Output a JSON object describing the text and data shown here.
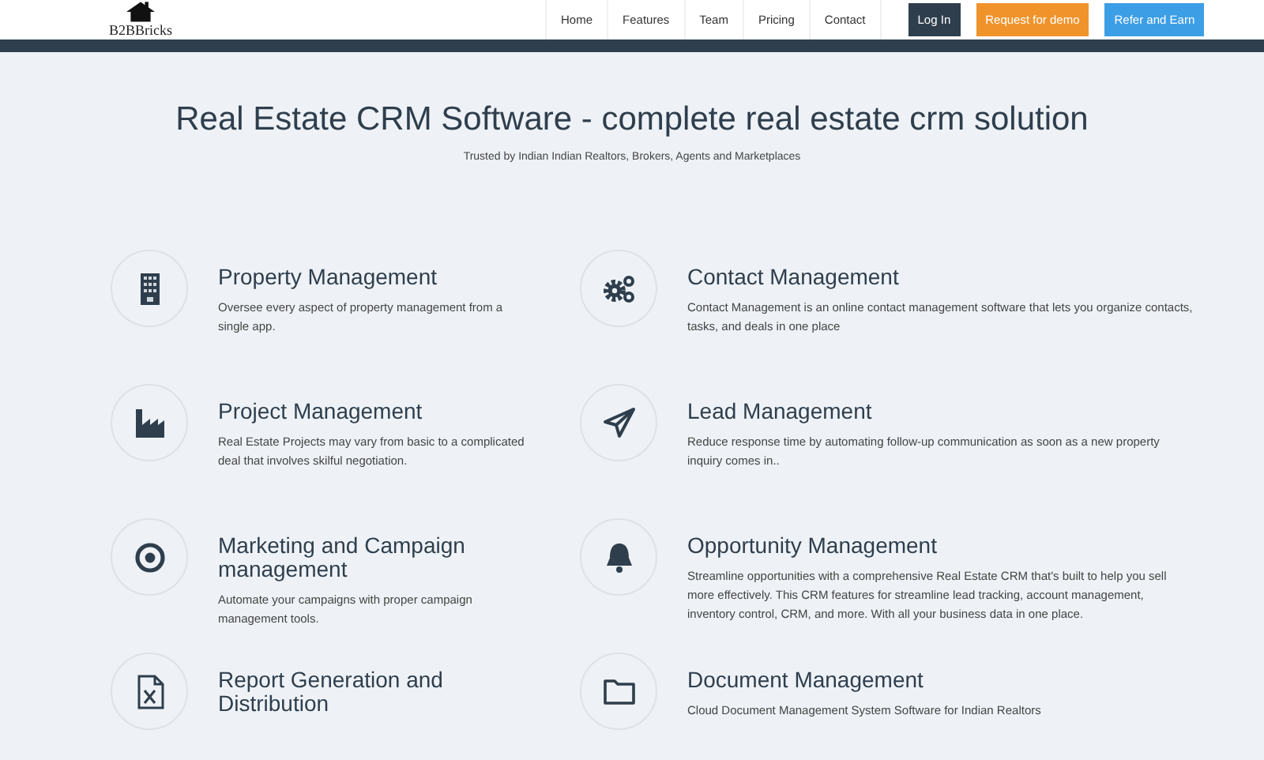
{
  "header": {
    "logo": "B2BBricks",
    "nav": [
      {
        "label": "Home"
      },
      {
        "label": "Features"
      },
      {
        "label": "Team"
      },
      {
        "label": "Pricing"
      },
      {
        "label": "Contact"
      }
    ],
    "buttons": [
      {
        "label": "Log In",
        "kind": "login"
      },
      {
        "label": "Request for demo",
        "kind": "demo"
      },
      {
        "label": "Refer and Earn",
        "kind": "refer"
      }
    ]
  },
  "hero": {
    "title": "Real Estate CRM Software - complete real estate crm solution",
    "subtitle": "Trusted by Indian Indian Realtors, Brokers, Agents and Marketplaces"
  },
  "features": [
    {
      "title": "Property Management",
      "description": "Oversee every aspect of property management from a single app."
    },
    {
      "title": "Contact Management",
      "description": "Contact Management is an online contact management software that lets you organize contacts, tasks, and deals in one place"
    },
    {
      "title": "Project Management",
      "description": "Real Estate Projects may vary from basic to a complicated deal that involves skilful negotiation."
    },
    {
      "title": "Lead Management",
      "description": "Reduce response time by automating follow-up communication as soon as a new property inquiry comes in.."
    },
    {
      "title": "Marketing and Campaign management",
      "description": "Automate your campaigns with proper campaign management tools."
    },
    {
      "title": "Opportunity Management",
      "description": "Streamline opportunities with a comprehensive Real Estate CRM that's built to help you sell more effectively. This CRM features for streamline lead tracking, account management, inventory control, CRM, and more. With all your business data in one place."
    },
    {
      "title": "Report Generation and Distribution"
    },
    {
      "title": "Document Management",
      "description": "Cloud Document Management System Software for Indian Realtors"
    }
  ]
}
